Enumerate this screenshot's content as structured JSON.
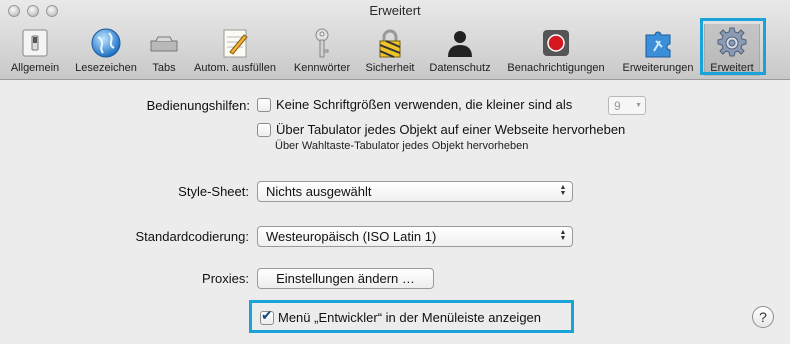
{
  "window": {
    "title": "Erweitert"
  },
  "toolbar": {
    "items": [
      {
        "label": "Allgemein",
        "icon": "switch-icon"
      },
      {
        "label": "Lesezeichen",
        "icon": "globe-icon"
      },
      {
        "label": "Tabs",
        "icon": "tabs-icon"
      },
      {
        "label": "Autom. ausfüllen",
        "icon": "pencil-form-icon"
      },
      {
        "label": "Kennwörter",
        "icon": "key-icon"
      },
      {
        "label": "Sicherheit",
        "icon": "padlock-icon"
      },
      {
        "label": "Datenschutz",
        "icon": "person-silhouette-icon"
      },
      {
        "label": "Benachrichtigungen",
        "icon": "record-icon"
      },
      {
        "label": "Erweiterungen",
        "icon": "puzzle-icon"
      },
      {
        "label": "Erweitert",
        "icon": "gear-icon",
        "selected": true
      }
    ]
  },
  "accessibility": {
    "label": "Bedienungshilfen:",
    "min_font_checkbox": {
      "label": "Keine Schriftgrößen verwenden, die kleiner sind als",
      "checked": false
    },
    "min_font_value": "9",
    "tab_checkbox": {
      "label": "Über Tabulator jedes Objekt auf einer Webseite hervorheben",
      "checked": false
    },
    "tab_hint": "Über Wahltaste-Tabulator jedes Objekt hervorheben"
  },
  "stylesheet": {
    "label": "Style-Sheet:",
    "value": "Nichts ausgewählt"
  },
  "encoding": {
    "label": "Standardcodierung:",
    "value": "Westeuropäisch (ISO Latin 1)"
  },
  "proxies": {
    "label": "Proxies:",
    "button": "Einstellungen ändern …"
  },
  "develop_menu": {
    "label": "Menü „Entwickler“ in der Menüleiste anzeigen",
    "checked": true
  },
  "help": {
    "label": "?"
  },
  "colors": {
    "highlight": "#1aa3d8",
    "record_red": "#d7171f"
  }
}
